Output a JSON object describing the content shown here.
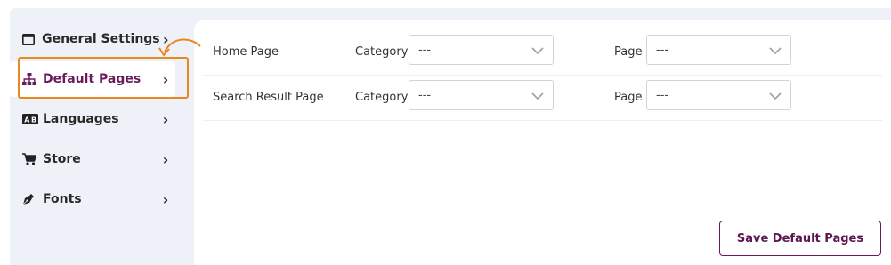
{
  "sidebar": {
    "items": [
      {
        "label": "General Settings",
        "icon": "window-icon",
        "active": false
      },
      {
        "label": "Default Pages",
        "icon": "sitemap-icon",
        "active": true
      },
      {
        "label": "Languages",
        "icon": "language-icon",
        "active": false
      },
      {
        "label": "Store",
        "icon": "cart-icon",
        "active": false
      },
      {
        "label": "Fonts",
        "icon": "pen-nib-icon",
        "active": false
      }
    ]
  },
  "settings_rows": [
    {
      "title": "Home Page",
      "category_label": "Category",
      "category_value": "---",
      "page_label": "Page",
      "page_value": "---"
    },
    {
      "title": "Search Result Page",
      "category_label": "Category",
      "category_value": "---",
      "page_label": "Page",
      "page_value": "---"
    }
  ],
  "save_button": {
    "label": "Save Default Pages"
  },
  "colors": {
    "accent": "#6b1a5b",
    "highlight": "#e8891f",
    "panel": "#eef1f7"
  }
}
